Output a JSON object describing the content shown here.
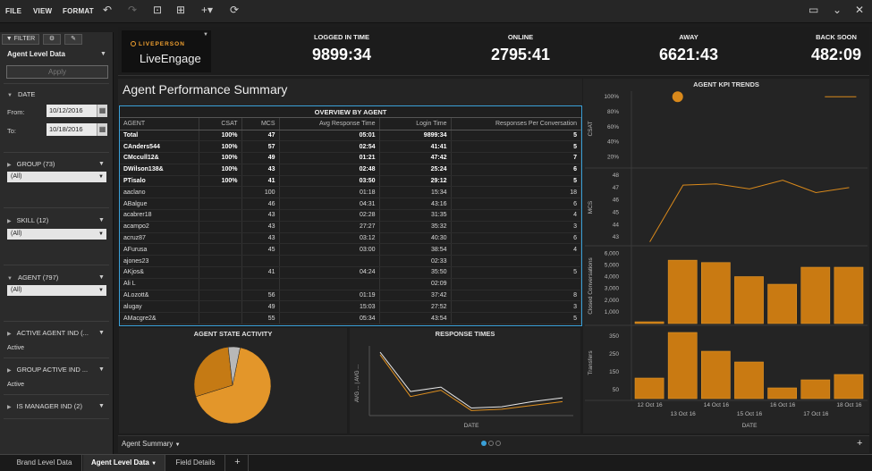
{
  "menu": {
    "file": "FILE",
    "view": "VIEW",
    "format": "FORMAT"
  },
  "sidebar": {
    "tabs": {
      "filter": "FILTER"
    },
    "title": "Agent Level Data",
    "apply": "Apply",
    "date": {
      "label": "DATE",
      "from_label": "From:",
      "from": "10/12/2016",
      "to_label": "To:",
      "to": "10/18/2016"
    },
    "group": {
      "label": "GROUP (73)",
      "value": "(All)"
    },
    "skill": {
      "label": "SKILL (12)",
      "value": "(All)"
    },
    "agent": {
      "label": "AGENT (797)",
      "value": "(All)"
    },
    "active_agent": {
      "label": "ACTIVE AGENT IND (...",
      "value": "Active"
    },
    "group_active": {
      "label": "GROUP ACTIVE IND ...",
      "value": "Active"
    },
    "is_manager": {
      "label": "IS MANAGER IND (2)"
    }
  },
  "logo": {
    "top": "LIVEPERSON",
    "name": "LiveEngage"
  },
  "kpis": [
    {
      "label": "LOGGED IN TIME",
      "value": "9899:34"
    },
    {
      "label": "ONLINE",
      "value": "2795:41"
    },
    {
      "label": "AWAY",
      "value": "6621:43"
    },
    {
      "label": "BACK SOON",
      "value": "482:09"
    }
  ],
  "page_title": "Agent Performance Summary",
  "overview": {
    "title": "OVERVIEW BY AGENT",
    "columns": [
      "AGENT",
      "CSAT",
      "MCS",
      "Avg Response Time",
      "Login Time",
      "Responses Per Conversation"
    ],
    "rows": [
      [
        "Total",
        "100%",
        "47",
        "05:01",
        "9899:34",
        "5"
      ],
      [
        "CAnders544",
        "100%",
        "57",
        "02:54",
        "41:41",
        "5"
      ],
      [
        "CMccull12&",
        "100%",
        "49",
        "01:21",
        "47:42",
        "7"
      ],
      [
        "DWilson138&",
        "100%",
        "43",
        "02:48",
        "25:24",
        "6"
      ],
      [
        "PTisalo",
        "100%",
        "41",
        "03:50",
        "29:12",
        "5"
      ],
      [
        "aaclano",
        "",
        "100",
        "01:18",
        "15:34",
        "18"
      ],
      [
        "ABalgue",
        "",
        "46",
        "04:31",
        "43:16",
        "6"
      ],
      [
        "acabrer18",
        "",
        "43",
        "02:28",
        "31:35",
        "4"
      ],
      [
        "acampo2",
        "",
        "43",
        "27:27",
        "35:32",
        "3"
      ],
      [
        "acruz87",
        "",
        "43",
        "03:12",
        "40:30",
        "6"
      ],
      [
        "AFurusa",
        "",
        "45",
        "03:00",
        "38:54",
        "4"
      ],
      [
        "ajones23",
        "",
        "",
        "",
        "02:33",
        ""
      ],
      [
        "AKjos&",
        "",
        "41",
        "04:24",
        "35:50",
        "5"
      ],
      [
        "Ali L",
        "",
        "",
        "",
        "02:09",
        ""
      ],
      [
        "ALozott&",
        "",
        "56",
        "01:19",
        "37:42",
        "8"
      ],
      [
        "alugay",
        "",
        "49",
        "15:03",
        "27:52",
        "3"
      ],
      [
        "AMacgre2&",
        "",
        "55",
        "05:34",
        "43:54",
        "5"
      ]
    ]
  },
  "agent_state": {
    "title": "AGENT STATE ACTIVITY"
  },
  "response_times": {
    "title": "RESPONSE TIMES",
    "xlabel": "DATE",
    "ylabel": "AVG ... | AVG ..."
  },
  "kpi_trends": {
    "title": "AGENT KPI TRENDS",
    "xlabel": "DATE"
  },
  "bottom": {
    "view_label": "Agent Summary"
  },
  "sheet_tabs": [
    "Brand Level Data",
    "Agent Level Data",
    "Field Details"
  ],
  "colors": {
    "accent": "#d9891b",
    "selection": "#3aa0d8"
  },
  "chart_data": [
    {
      "type": "pie",
      "title": "AGENT STATE ACTIVITY",
      "values": [
        67,
        28,
        5
      ],
      "colors": [
        "#e3962a",
        "#c57a14",
        "#b8b8b8"
      ]
    },
    {
      "type": "line",
      "title": "RESPONSE TIMES",
      "xlabel": "DATE",
      "ylabel": "AVG ... | AVG ...",
      "x": [
        "12 Oct 16",
        "13 Oct 16",
        "14 Oct 16",
        "15 Oct 16",
        "16 Oct 16",
        "17 Oct 16",
        "18 Oct 16"
      ],
      "series": [
        {
          "values": [
            100,
            38,
            45,
            12,
            14,
            22,
            28
          ],
          "color": "#e8e8e8"
        },
        {
          "values": [
            96,
            30,
            40,
            8,
            10,
            16,
            22
          ],
          "color": "#e0901e"
        }
      ],
      "ylim": [
        0,
        110
      ]
    },
    {
      "type": "line",
      "title": "CSAT",
      "ylabel": "CSAT",
      "yticks": [
        "100%",
        "80%",
        "60%",
        "40%",
        "20%"
      ],
      "x": [
        "12 Oct 16",
        "13 Oct 16",
        "14 Oct 16",
        "15 Oct 16",
        "16 Oct 16",
        "17 Oct 16",
        "18 Oct 16"
      ],
      "values": [
        null,
        100,
        null,
        null,
        null,
        100,
        100
      ],
      "ylim": [
        10,
        105
      ]
    },
    {
      "type": "line",
      "title": "MCS",
      "ylabel": "MCS",
      "yticks": [
        48,
        47,
        46,
        45,
        44,
        43
      ],
      "x": [
        "12 Oct 16",
        "13 Oct 16",
        "14 Oct 16",
        "15 Oct 16",
        "16 Oct 16",
        "17 Oct 16",
        "18 Oct 16"
      ],
      "values": [
        42.6,
        47.2,
        47.3,
        46.9,
        47.6,
        46.6,
        47.0
      ],
      "ylim": [
        42.5,
        48.3
      ]
    },
    {
      "type": "bar",
      "title": "Closed Conversations",
      "ylabel": "Closed Conversations",
      "yticks": [
        6000,
        5000,
        4000,
        3000,
        2000,
        1000
      ],
      "ytick_labels": [
        "6,000",
        "5,000",
        "4,000",
        "3,000",
        "2,000",
        "1,000"
      ],
      "categories": [
        "12 Oct 16",
        "13 Oct 16",
        "14 Oct 16",
        "15 Oct 16",
        "16 Oct 16",
        "17 Oct 16",
        "18 Oct 16"
      ],
      "values": [
        150,
        5400,
        5200,
        4000,
        3350,
        4800,
        4800
      ],
      "ylim": [
        0,
        6400
      ]
    },
    {
      "type": "bar",
      "title": "Transfers",
      "ylabel": "Transfers",
      "yticks": [
        350,
        250,
        150,
        50
      ],
      "categories": [
        "12 Oct 16",
        "13 Oct 16",
        "14 Oct 16",
        "15 Oct 16",
        "16 Oct 16",
        "17 Oct 16",
        "18 Oct 16"
      ],
      "values": [
        115,
        370,
        265,
        205,
        60,
        105,
        135
      ],
      "ylim": [
        0,
        400
      ]
    }
  ]
}
